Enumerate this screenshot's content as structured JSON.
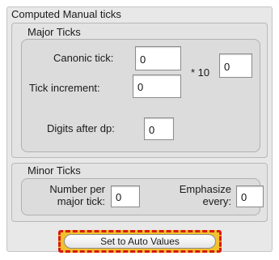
{
  "panel": {
    "title": "Computed Manual ticks"
  },
  "major_ticks": {
    "title": "Major Ticks",
    "canonic_tick_label": "Canonic tick:",
    "canonic_tick_value": "0",
    "tick_increment_label": "Tick increment:",
    "tick_increment_value": "0",
    "times_ten_label": "* 10",
    "exponent_value": "0",
    "digits_after_dp_label": "Digits after dp:",
    "digits_after_dp_value": "0"
  },
  "minor_ticks": {
    "title": "Minor Ticks",
    "number_per_label_line1": "Number per",
    "number_per_label_line2": "major tick:",
    "number_per_value": "0",
    "emphasize_label_line1": "Emphasize",
    "emphasize_label_line2": "every:",
    "emphasize_value": "0"
  },
  "actions": {
    "auto_values_label": "Set to Auto Values"
  }
}
